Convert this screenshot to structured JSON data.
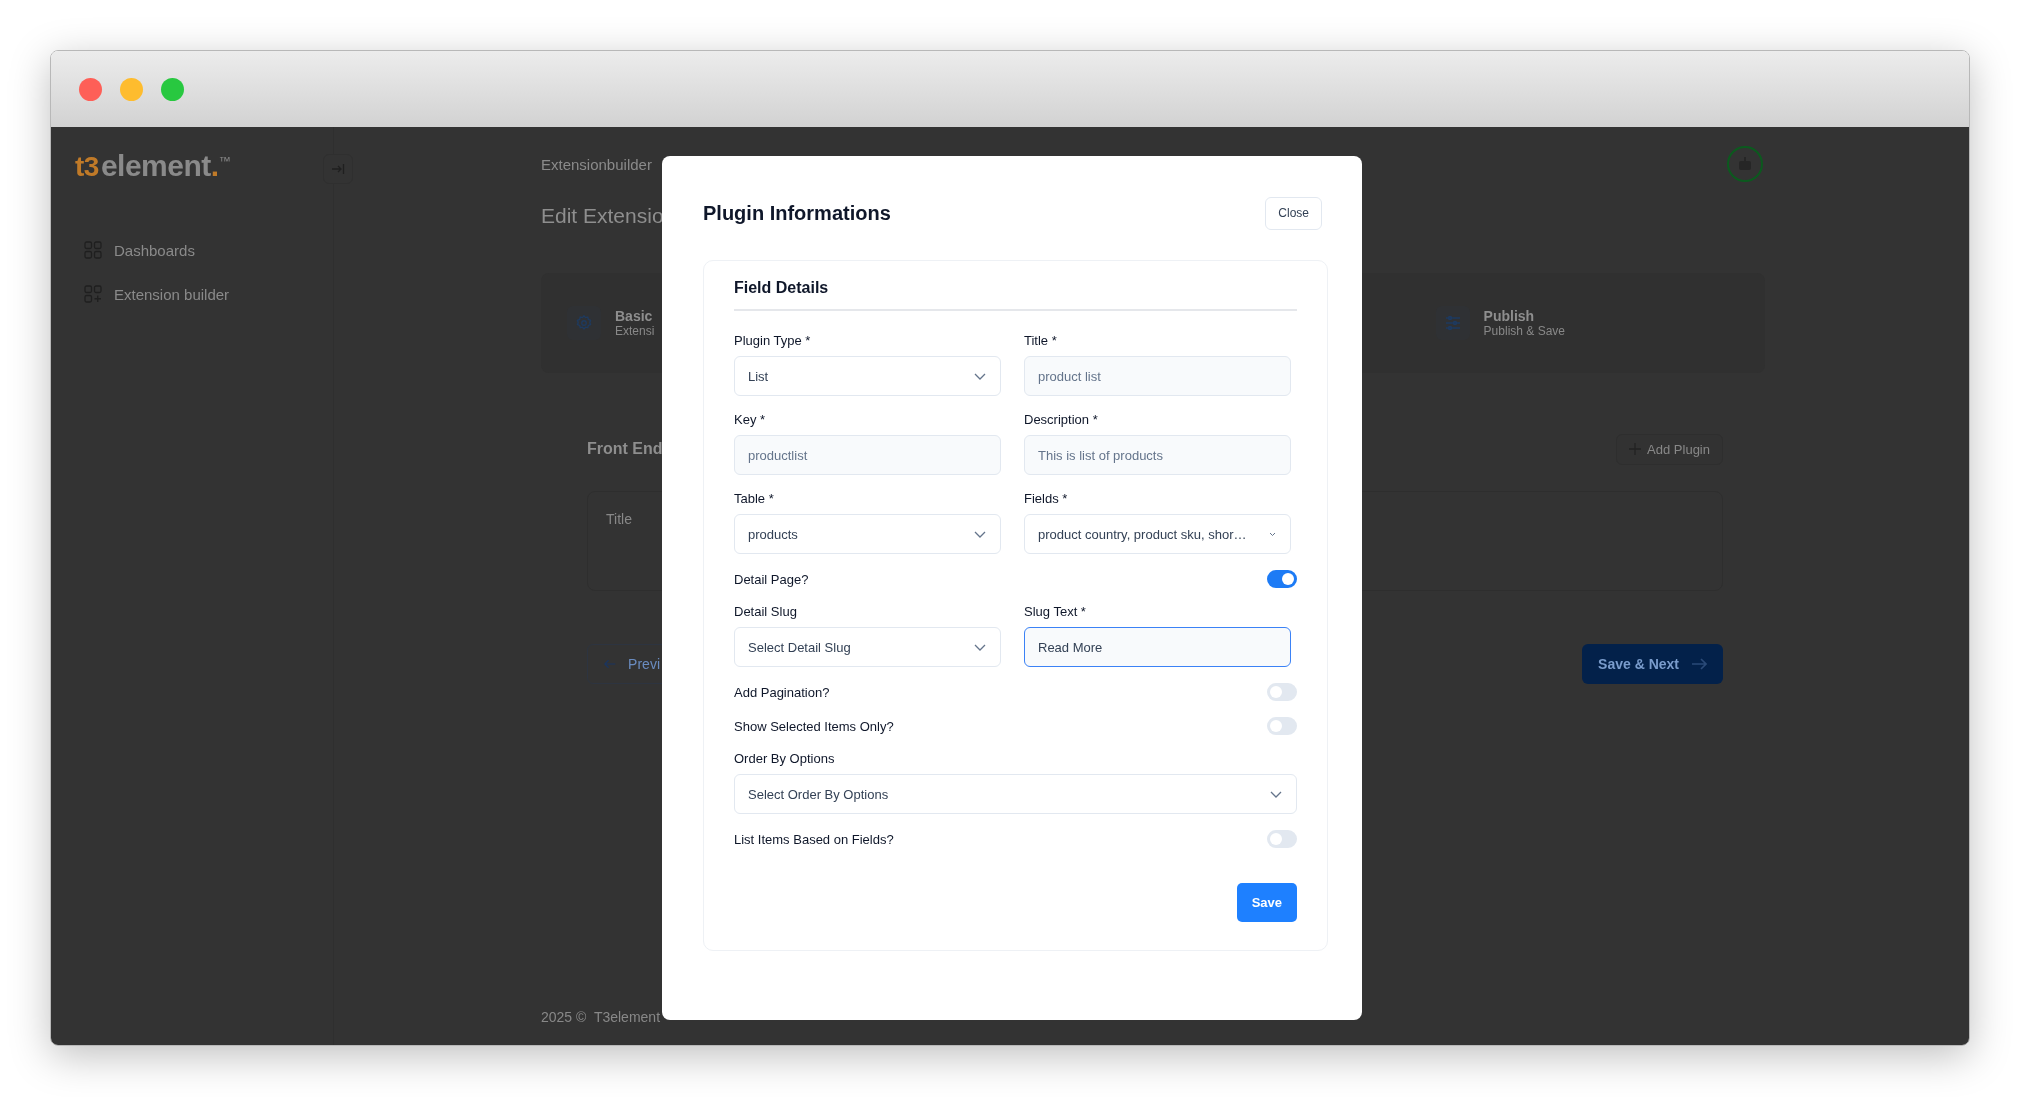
{
  "window": {
    "controls": [
      {
        "color": "#fe5f57"
      },
      {
        "color": "#febc2e"
      },
      {
        "color": "#28c840"
      }
    ]
  },
  "sidebar": {
    "logo": {
      "prefix": "t3",
      "text": "element",
      "accent": ".",
      "mark": "™"
    },
    "items": [
      {
        "label": "Dashboards",
        "kind": "grid"
      },
      {
        "label": "Extension builder",
        "kind": "grid-plus"
      }
    ]
  },
  "header": {
    "breadcrumb": "Extensionbuilder"
  },
  "page": {
    "title": "Edit Extensio",
    "steps": [
      {
        "title": "Basic",
        "subtitle": "Extensi",
        "kind": "gear"
      },
      {
        "title": "Publish",
        "subtitle": "Publish & Save",
        "kind": "sliders"
      }
    ],
    "section": {
      "title": "Front End",
      "add_button": "Add Plugin",
      "table": {
        "columns": [
          "Title"
        ]
      }
    },
    "prev_button": "Previ",
    "next_button": "Save & Next"
  },
  "footer": "2025 ©  T3element",
  "modal": {
    "title": "Plugin Informations",
    "close_button": "Close",
    "card": {
      "title": "Field Details",
      "fields": [
        {
          "kind": "select",
          "label": "Plugin Type *",
          "value": "List"
        },
        {
          "kind": "input",
          "label": "Title *",
          "placeholder": "product list"
        },
        {
          "kind": "input",
          "label": "Key *",
          "placeholder": "productlist"
        },
        {
          "kind": "input",
          "label": "Description *",
          "placeholder": "This is list of products"
        },
        {
          "kind": "select",
          "label": "Table *",
          "value": "products"
        },
        {
          "kind": "select",
          "label": "Fields *",
          "value": "product country, product sku, shor…",
          "small_caret": true
        },
        {
          "kind": "toggle",
          "label": "Detail Page?",
          "on": true
        },
        {
          "kind": "select",
          "label": "Detail Slug",
          "value": "Select Detail Slug"
        },
        {
          "kind": "input",
          "label": "Slug Text *",
          "value": "Read More",
          "focused": true
        },
        {
          "kind": "toggle",
          "label": "Add Pagination?",
          "on": false
        },
        {
          "kind": "toggle",
          "label": "Show Selected Items Only?",
          "on": false
        },
        {
          "kind": "select",
          "label": "Order By Options",
          "value": "Select Order By Options",
          "wide": true
        },
        {
          "kind": "toggle",
          "label": "List Items Based on Fields?",
          "on": false
        }
      ],
      "save_button": "Save"
    }
  }
}
